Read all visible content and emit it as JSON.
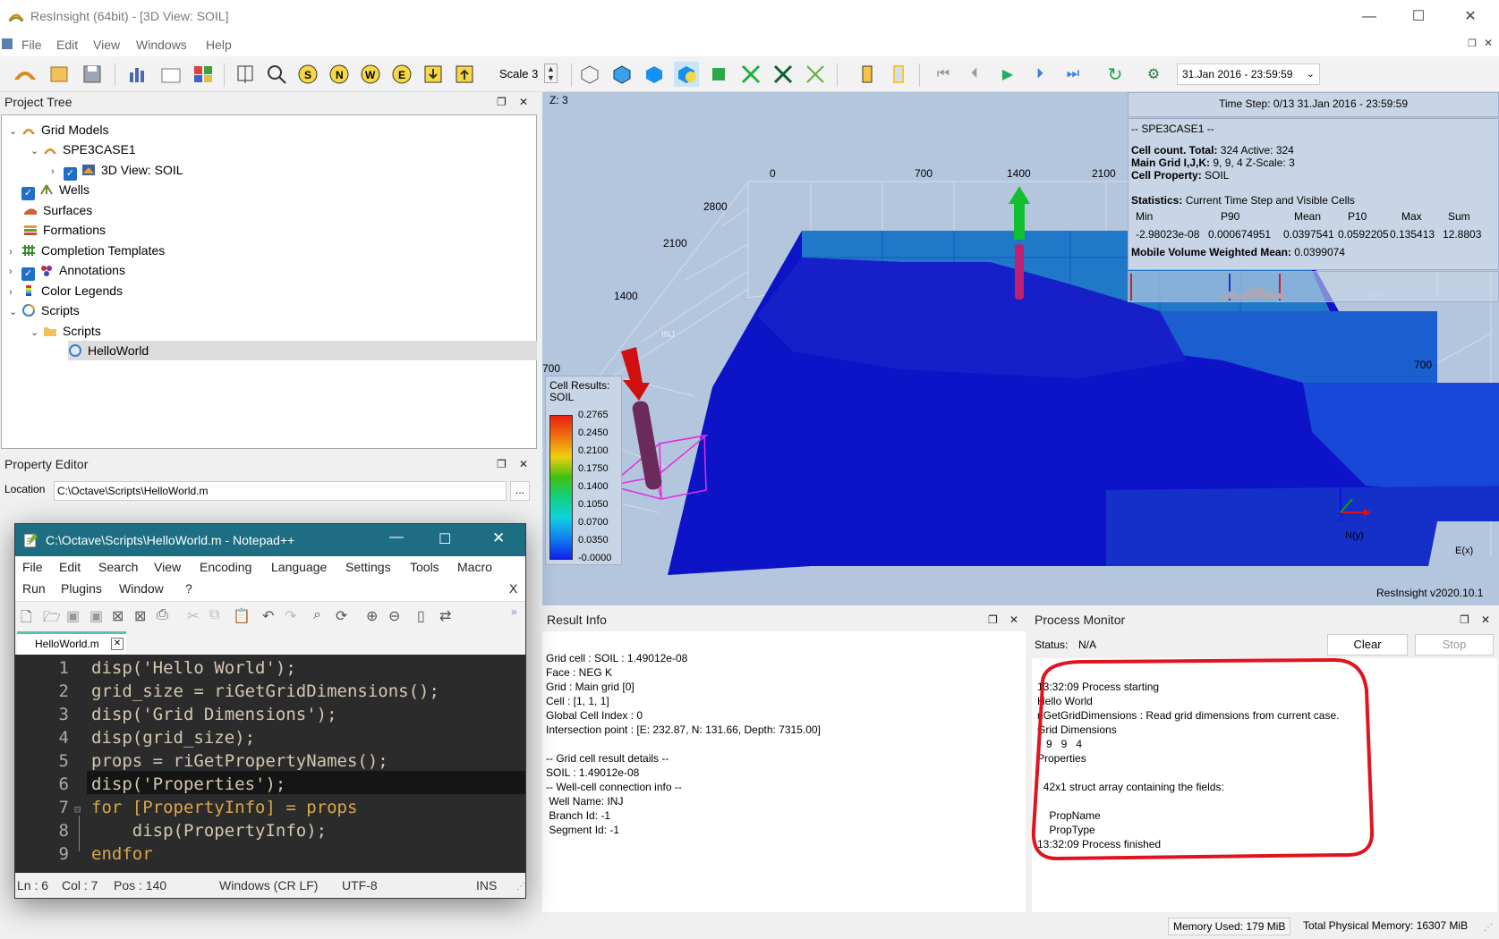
{
  "window": {
    "title": "ResInsight (64bit) - [3D View: SOIL]",
    "minimize": "—",
    "maximize": "☐",
    "close": "✕"
  },
  "menu": [
    "File",
    "Edit",
    "View",
    "Windows",
    "Help"
  ],
  "toolbar": {
    "scale_label": "Scale 3",
    "time_value": "31.Jan 2016 - 23:59:59"
  },
  "project_tree": {
    "title": "Project Tree",
    "items": [
      {
        "label": "Grid Models",
        "arrow": "⌄",
        "icon": "grid-models-icon"
      },
      {
        "label": "SPE3CASE1",
        "arrow": "⌄",
        "icon": "case-icon"
      },
      {
        "label": "3D View: SOIL",
        "arrow": "›",
        "icon": "3d-view-icon"
      },
      {
        "label": "Wells",
        "arrow": "",
        "icon": "wells-icon"
      },
      {
        "label": "Surfaces",
        "arrow": "",
        "icon": "surfaces-icon"
      },
      {
        "label": "Formations",
        "arrow": "",
        "icon": "formations-icon"
      },
      {
        "label": "Completion Templates",
        "arrow": "›",
        "icon": "completion-icon"
      },
      {
        "label": "Annotations",
        "arrow": "›",
        "icon": "annotations-icon"
      },
      {
        "label": "Color Legends",
        "arrow": "›",
        "icon": "color-legends-icon"
      },
      {
        "label": "Scripts",
        "arrow": "⌄",
        "icon": "scripts-icon"
      },
      {
        "label": "Scripts",
        "arrow": "⌄",
        "icon": "folder-icon"
      },
      {
        "label": "HelloWorld",
        "arrow": "",
        "icon": "script-file-icon"
      }
    ]
  },
  "property_editor": {
    "title": "Property Editor",
    "location_label": "Location",
    "location_value": "C:\\Octave\\Scripts\\HelloWorld.m",
    "browse": "..."
  },
  "view3d": {
    "z_label": "Z: 3",
    "time_step": "Time Step: 0/13 31.Jan 2016 - 23:59:59",
    "case_header": "-- SPE3CASE1 --",
    "cell_count_label": "Cell count. Total:",
    "cell_count_value": "324 Active: 324",
    "main_grid_label": "Main Grid I,J,K:",
    "main_grid_value": "9, 9, 4 Z-Scale: 3",
    "cell_property_label": "Cell Property:",
    "cell_property_value": "SOIL",
    "stats_label": "Statistics:",
    "stats_value": "Current Time Step and Visible Cells",
    "stats_headers": [
      "Min",
      "P90",
      "Mean",
      "P10",
      "Max",
      "Sum"
    ],
    "stats_values": [
      "-2.98023e-08",
      "0.000674951",
      "0.0397541",
      "0.0592205",
      "0.135413",
      "12.8803"
    ],
    "mobile_label": "Mobile Volume Weighted Mean:",
    "mobile_value": "0.0399074",
    "axis_labels": [
      "0",
      "700",
      "1400",
      "2100",
      "2800",
      "2100",
      "1400",
      "700",
      "700",
      "1400"
    ],
    "well_label": "INJ",
    "legend_title": "Cell Results:",
    "legend_sub": "SOIL",
    "legend_values": [
      "0.2765",
      "0.2450",
      "0.2100",
      "0.1750",
      "0.1400",
      "0.1050",
      "0.0700",
      "0.0350",
      "-0.0000"
    ],
    "version": "ResInsight v2020.10.1",
    "axis_n": "N(y)",
    "axis_e": "E(x)",
    "axis_z": "Z"
  },
  "notepad": {
    "title": "C:\\Octave\\Scripts\\HelloWorld.m - Notepad++",
    "menu1": [
      "File",
      "Edit",
      "Search",
      "View",
      "Encoding",
      "Language",
      "Settings",
      "Tools",
      "Macro"
    ],
    "menu2": [
      "Run",
      "Plugins",
      "Window",
      "?"
    ],
    "menu_close": "X",
    "tab": "HelloWorld.m",
    "lines": [
      "disp('Hello World');",
      "grid_size = riGetGridDimensions();",
      "disp('Grid Dimensions');",
      "disp(grid_size);",
      "props = riGetPropertyNames();",
      "disp('Properties');",
      "for [PropertyInfo] = props",
      "    disp(PropertyInfo);",
      "endfor"
    ],
    "line_numbers": [
      "1",
      "2",
      "3",
      "4",
      "5",
      "6",
      "7",
      "8",
      "9"
    ],
    "status": {
      "ln": "Ln : 6",
      "col": "Col : 7",
      "pos": "Pos : 140",
      "eol": "Windows (CR LF)",
      "enc": "UTF-8",
      "mode": "INS"
    }
  },
  "result_info": {
    "title": "Result Info",
    "lines": [
      "Grid cell : SOIL : 1.49012e-08",
      "Face : NEG K",
      "Grid : Main grid [0]",
      "Cell : [1, 1, 1]",
      "Global Cell Index : 0",
      "Intersection point : [E: 232.87, N: 131.66, Depth: 7315.00]",
      "",
      "-- Grid cell result details --",
      "SOIL : 1.49012e-08",
      "-- Well-cell connection info --",
      " Well Name: INJ",
      " Branch Id: -1",
      " Segment Id: -1"
    ]
  },
  "process_monitor": {
    "title": "Process Monitor",
    "status_label": "Status:",
    "status_value": "N/A",
    "clear": "Clear",
    "stop": "Stop",
    "lines": [
      "13:32:09 Process starting",
      "Hello World",
      "riGetGridDimensions : Read grid dimensions from current case.",
      "Grid Dimensions",
      "   9   9   4",
      "Properties",
      "",
      "  42x1 struct array containing the fields:",
      "",
      "    PropName",
      "    PropType",
      "13:32:09 Process finished"
    ]
  },
  "statusbar": {
    "memory_used": "Memory Used: 179 MiB",
    "total_memory": "Total Physical Memory: 16307 MiB"
  },
  "colors": {
    "accent": "#1f6fc9",
    "highlight_circle": "#e0141e",
    "grid_dark": "#0a10c8"
  }
}
